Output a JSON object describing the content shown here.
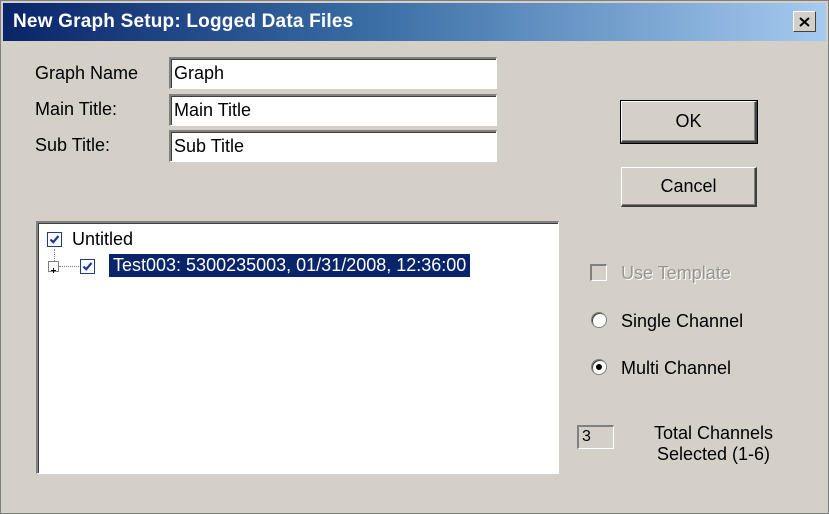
{
  "window": {
    "title": "New Graph Setup: Logged Data Files"
  },
  "form": {
    "graph_name_label": "Graph Name",
    "graph_name_value": "Graph",
    "main_title_label": "Main Title:",
    "main_title_value": "Main Title",
    "sub_title_label": "Sub Title:",
    "sub_title_value": "Sub Title"
  },
  "buttons": {
    "ok_label": "OK",
    "cancel_label": "Cancel"
  },
  "tree": {
    "root": {
      "label": "Untitled",
      "checked": true
    },
    "children": [
      {
        "label": "Test003: 5300235003, 01/31/2008, 12:36:00",
        "checked": true,
        "selected": true,
        "expandable": true
      }
    ]
  },
  "options": {
    "use_template_label": "Use Template",
    "use_template_checked": false,
    "use_template_enabled": false,
    "single_channel_label": "Single Channel",
    "multi_channel_label": "Multi Channel",
    "selected_mode": "Multi Channel"
  },
  "channels": {
    "count": "3",
    "label_line1": "Total Channels",
    "label_line2": "Selected (1-6)"
  },
  "colors": {
    "titlebar_start": "#0a246a",
    "selection": "#0a246a",
    "face": "#d4d0c8"
  }
}
